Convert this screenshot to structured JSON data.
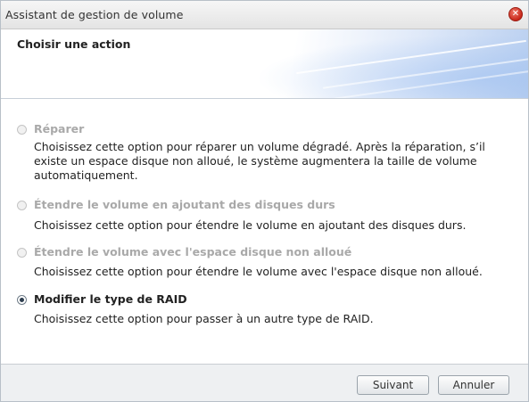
{
  "window": {
    "title": "Assistant de gestion de volume",
    "close_glyph": "✕"
  },
  "header": {
    "heading": "Choisir une action"
  },
  "options": [
    {
      "label": "Réparer",
      "description": "Choisissez cette option pour réparer un volume dégradé. Après la réparation, s’il existe un espace disque non alloué, le système augmentera la taille de volume automatiquement.",
      "enabled": false,
      "selected": false
    },
    {
      "label": "Étendre le volume en ajoutant des disques durs",
      "description": "Choisissez cette option pour étendre le volume en ajoutant des disques durs.",
      "enabled": false,
      "selected": false
    },
    {
      "label": "Étendre le volume avec l'espace disque non alloué",
      "description": "Choisissez cette option pour étendre le volume avec l'espace disque non alloué.",
      "enabled": false,
      "selected": false
    },
    {
      "label": "Modifier le type de RAID",
      "description": "Choisissez cette option pour passer à un autre type de RAID.",
      "enabled": true,
      "selected": true
    }
  ],
  "footer": {
    "next_label": "Suivant",
    "cancel_label": "Annuler"
  }
}
